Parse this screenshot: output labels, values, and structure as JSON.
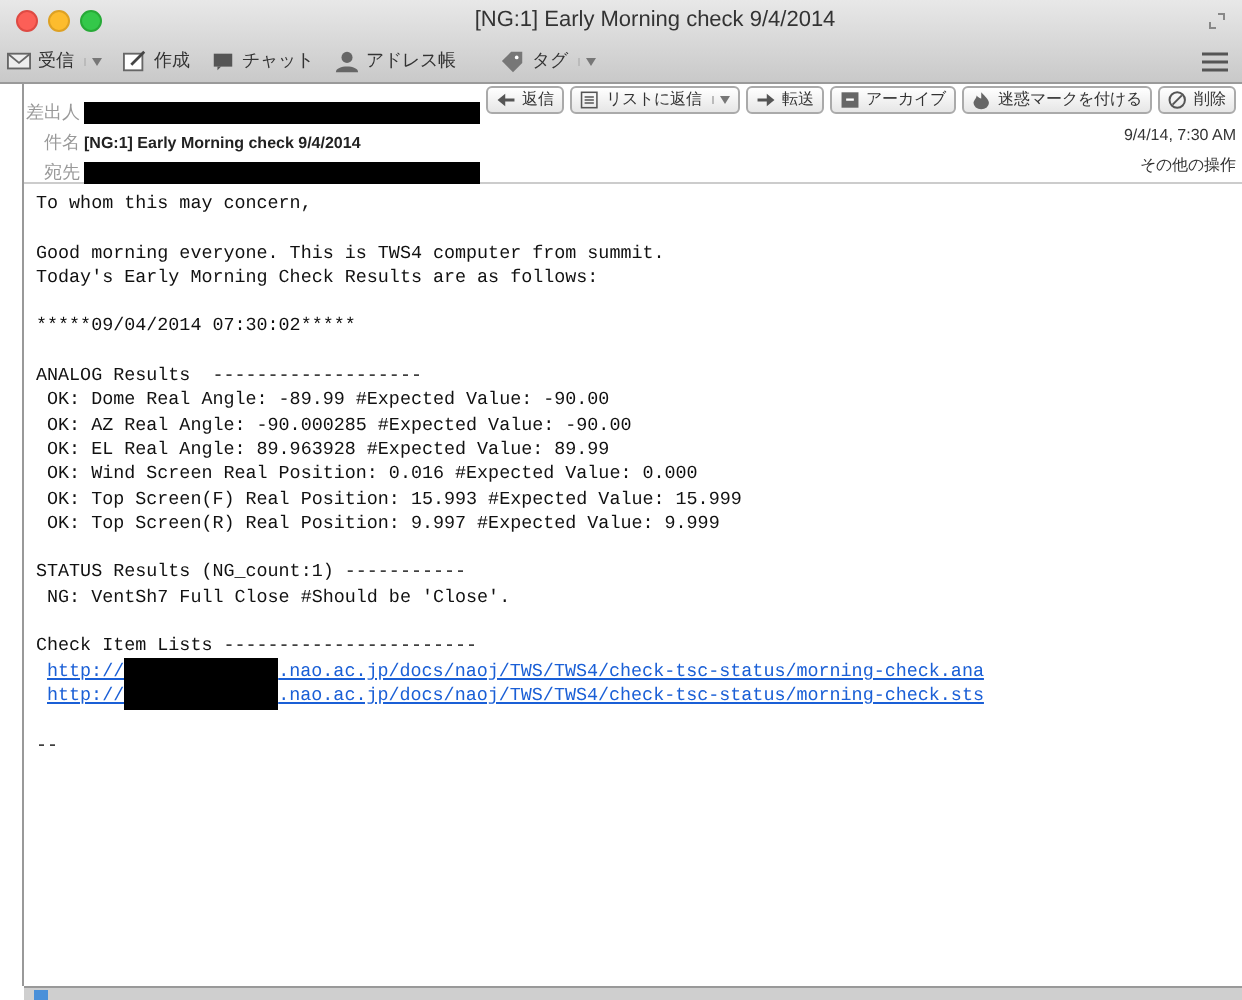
{
  "window": {
    "title": "[NG:1] Early Morning check 9/4/2014"
  },
  "toolbar": [
    {
      "kind": "inbox",
      "label": "受信",
      "dropdown": true
    },
    {
      "kind": "compose",
      "label": "作成",
      "dropdown": false
    },
    {
      "kind": "chat",
      "label": "チャット",
      "dropdown": false
    },
    {
      "kind": "contacts",
      "label": "アドレス帳",
      "dropdown": false
    },
    {
      "kind": "tag",
      "label": "タグ",
      "dropdown": true
    }
  ],
  "header": {
    "from_label": "差出人",
    "subject_label": "件名",
    "subject": "[NG:1] Early Morning check 9/4/2014",
    "to_label": "宛先",
    "date": "9/4/14, 7:30 AM",
    "more": "その他の操作",
    "actions": [
      {
        "kind": "reply",
        "label": "返信",
        "dropdown": false
      },
      {
        "kind": "reply-list",
        "label": "リストに返信",
        "dropdown": true
      },
      {
        "kind": "forward",
        "label": "転送",
        "dropdown": false
      },
      {
        "kind": "archive",
        "label": "アーカイブ",
        "dropdown": false
      },
      {
        "kind": "junk",
        "label": "迷惑マークを付ける",
        "dropdown": false
      },
      {
        "kind": "delete",
        "label": "削除",
        "dropdown": false
      }
    ]
  },
  "body": [
    {
      "kind": "text",
      "text": "To whom this may concern,"
    },
    {
      "kind": "blank"
    },
    {
      "kind": "text",
      "text": "Good morning everyone. This is TWS4 computer from summit."
    },
    {
      "kind": "text",
      "text": "Today's Early Morning Check Results are as follows:"
    },
    {
      "kind": "blank"
    },
    {
      "kind": "text",
      "text": "*****09/04/2014 07:30:02*****"
    },
    {
      "kind": "blank"
    },
    {
      "kind": "text",
      "text": "ANALOG Results  -------------------"
    },
    {
      "kind": "text",
      "text": " OK: Dome Real Angle: -89.99 #Expected Value: -90.00"
    },
    {
      "kind": "text",
      "text": " OK: AZ Real Angle: -90.000285 #Expected Value: -90.00"
    },
    {
      "kind": "text",
      "text": " OK: EL Real Angle: 89.963928 #Expected Value: 89.99"
    },
    {
      "kind": "text",
      "text": " OK: Wind Screen Real Position: 0.016 #Expected Value: 0.000"
    },
    {
      "kind": "text",
      "text": " OK: Top Screen(F) Real Position: 15.993 #Expected Value: 15.999"
    },
    {
      "kind": "text",
      "text": " OK: Top Screen(R) Real Position: 9.997 #Expected Value: 9.999"
    },
    {
      "kind": "blank"
    },
    {
      "kind": "text",
      "text": "STATUS Results (NG_count:1) -----------"
    },
    {
      "kind": "text",
      "text": " NG: VentSh7 Full Close #Should be 'Close'."
    },
    {
      "kind": "blank"
    },
    {
      "kind": "text",
      "text": "Check Item Lists -----------------------"
    },
    {
      "kind": "link",
      "prefix": "http://",
      "suffix": ".nao.ac.jp/docs/naoj/TWS/TWS4/check-tsc-status/morning-check.ana"
    },
    {
      "kind": "link",
      "prefix": "http://",
      "suffix": ".nao.ac.jp/docs/naoj/TWS/TWS4/check-tsc-status/morning-check.sts"
    },
    {
      "kind": "blank"
    },
    {
      "kind": "text",
      "text": "--"
    }
  ]
}
